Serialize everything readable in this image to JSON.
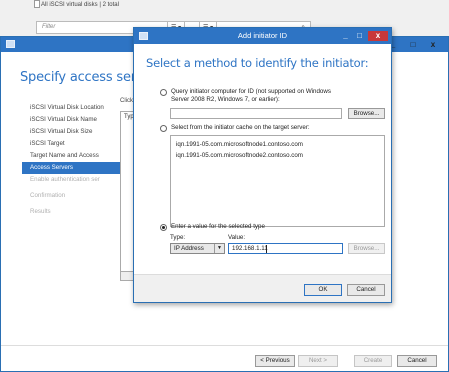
{
  "server_manager": {
    "subtitle": "All iSCSI virtual disks | 2 total",
    "filter_placeholder": "Filter",
    "list_glyph": "☰",
    "chevron": "▾"
  },
  "wizard": {
    "title": "Specify access servers",
    "nav": [
      {
        "label": "iSCSI Virtual Disk Location",
        "state": "normal"
      },
      {
        "label": "iSCSI Virtual Disk Name",
        "state": "normal"
      },
      {
        "label": "iSCSI Virtual Disk Size",
        "state": "normal"
      },
      {
        "label": "iSCSI Target",
        "state": "normal"
      },
      {
        "label": "Target Name and Access",
        "state": "normal"
      },
      {
        "label": "Access Servers",
        "state": "selected"
      },
      {
        "label": "Enable authentication ser",
        "state": "disabled"
      },
      {
        "label": "Confirmation",
        "state": "disabled"
      },
      {
        "label": "Results",
        "state": "disabled"
      }
    ],
    "click_text": "Click",
    "list_header": "Typ",
    "buttons": {
      "previous": "< Previous",
      "next": "Next >",
      "create": "Create",
      "cancel": "Cancel"
    },
    "window_controls": {
      "minimize": "_",
      "maximize": "□",
      "close": "x"
    }
  },
  "dialog": {
    "title": "Add initiator ID",
    "heading": "Select a method to identify the initiator:",
    "window_controls": {
      "minimize": "_",
      "maximize": "□",
      "close": "x"
    },
    "option_query": {
      "line1": "Query initiator computer for ID (not supported on Windows",
      "line2": "Server 2008 R2, Windows 7, or earlier):",
      "browse": "Browse...",
      "selected": false
    },
    "option_cache": {
      "label": "Select from the initiator cache on the target server:",
      "items": [
        "iqn.1991-05.com.microsoftnode1.contoso.com",
        "iqn.1991-05.com.microsoftnode2.contoso.com"
      ],
      "selected": false
    },
    "option_enter": {
      "label": "Enter a value for the selected type",
      "type_label": "Type:",
      "type_value": "IP Address",
      "value_label": "Value:",
      "value": "192.168.1.11",
      "browse": "Browse...",
      "selected": true
    },
    "buttons": {
      "ok": "OK",
      "cancel": "Cancel"
    }
  },
  "colors": {
    "accent": "#2e74c4",
    "close_red": "#c7383a"
  }
}
